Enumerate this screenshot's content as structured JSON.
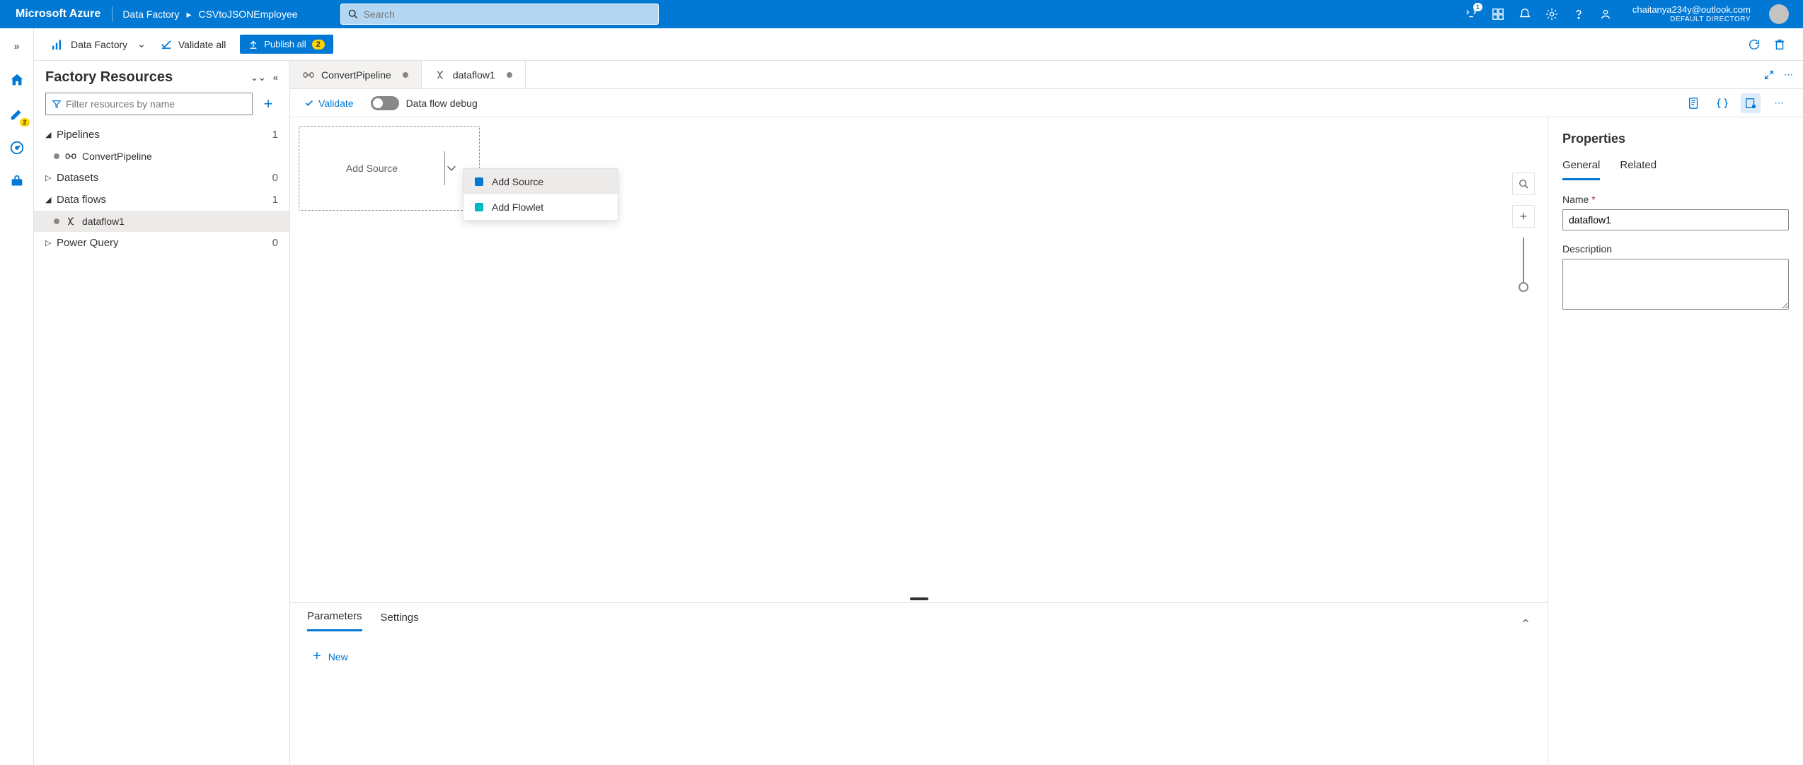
{
  "header": {
    "brand": "Microsoft Azure",
    "breadcrumb": [
      "Data Factory",
      "CSVtoJSONEmployee"
    ],
    "search_placeholder": "Search",
    "notifications_badge": "1",
    "user_email": "chaitanya234y@outlook.com",
    "user_directory": "DEFAULT DIRECTORY"
  },
  "rail": {
    "pencil_badge": "2"
  },
  "toolbar": {
    "product": "Data Factory",
    "validate_all": "Validate all",
    "publish_all": "Publish all",
    "publish_count": "2"
  },
  "sidebar": {
    "title": "Factory Resources",
    "filter_placeholder": "Filter resources by name",
    "groups": [
      {
        "label": "Pipelines",
        "count": "1",
        "expanded": true,
        "children": [
          {
            "label": "ConvertPipeline",
            "unsaved": true
          }
        ]
      },
      {
        "label": "Datasets",
        "count": "0",
        "expanded": false,
        "children": []
      },
      {
        "label": "Data flows",
        "count": "1",
        "expanded": true,
        "children": [
          {
            "label": "dataflow1",
            "unsaved": true,
            "selected": true
          }
        ]
      },
      {
        "label": "Power Query",
        "count": "0",
        "expanded": false,
        "children": []
      }
    ]
  },
  "tabs": [
    {
      "label": "ConvertPipeline",
      "unsaved": true,
      "active": false
    },
    {
      "label": "dataflow1",
      "unsaved": true,
      "active": true
    }
  ],
  "action_bar": {
    "validate": "Validate",
    "debug_label": "Data flow debug"
  },
  "canvas": {
    "add_source_placeholder": "Add Source",
    "dropdown": [
      {
        "label": "Add Source",
        "highlight": true
      },
      {
        "label": "Add Flowlet",
        "highlight": false
      }
    ]
  },
  "bottom": {
    "tabs": [
      "Parameters",
      "Settings"
    ],
    "active": "Parameters",
    "new_label": "New"
  },
  "properties": {
    "title": "Properties",
    "tabs": [
      "General",
      "Related"
    ],
    "active": "General",
    "name_label": "Name",
    "name_value": "dataflow1",
    "description_label": "Description",
    "description_value": ""
  }
}
